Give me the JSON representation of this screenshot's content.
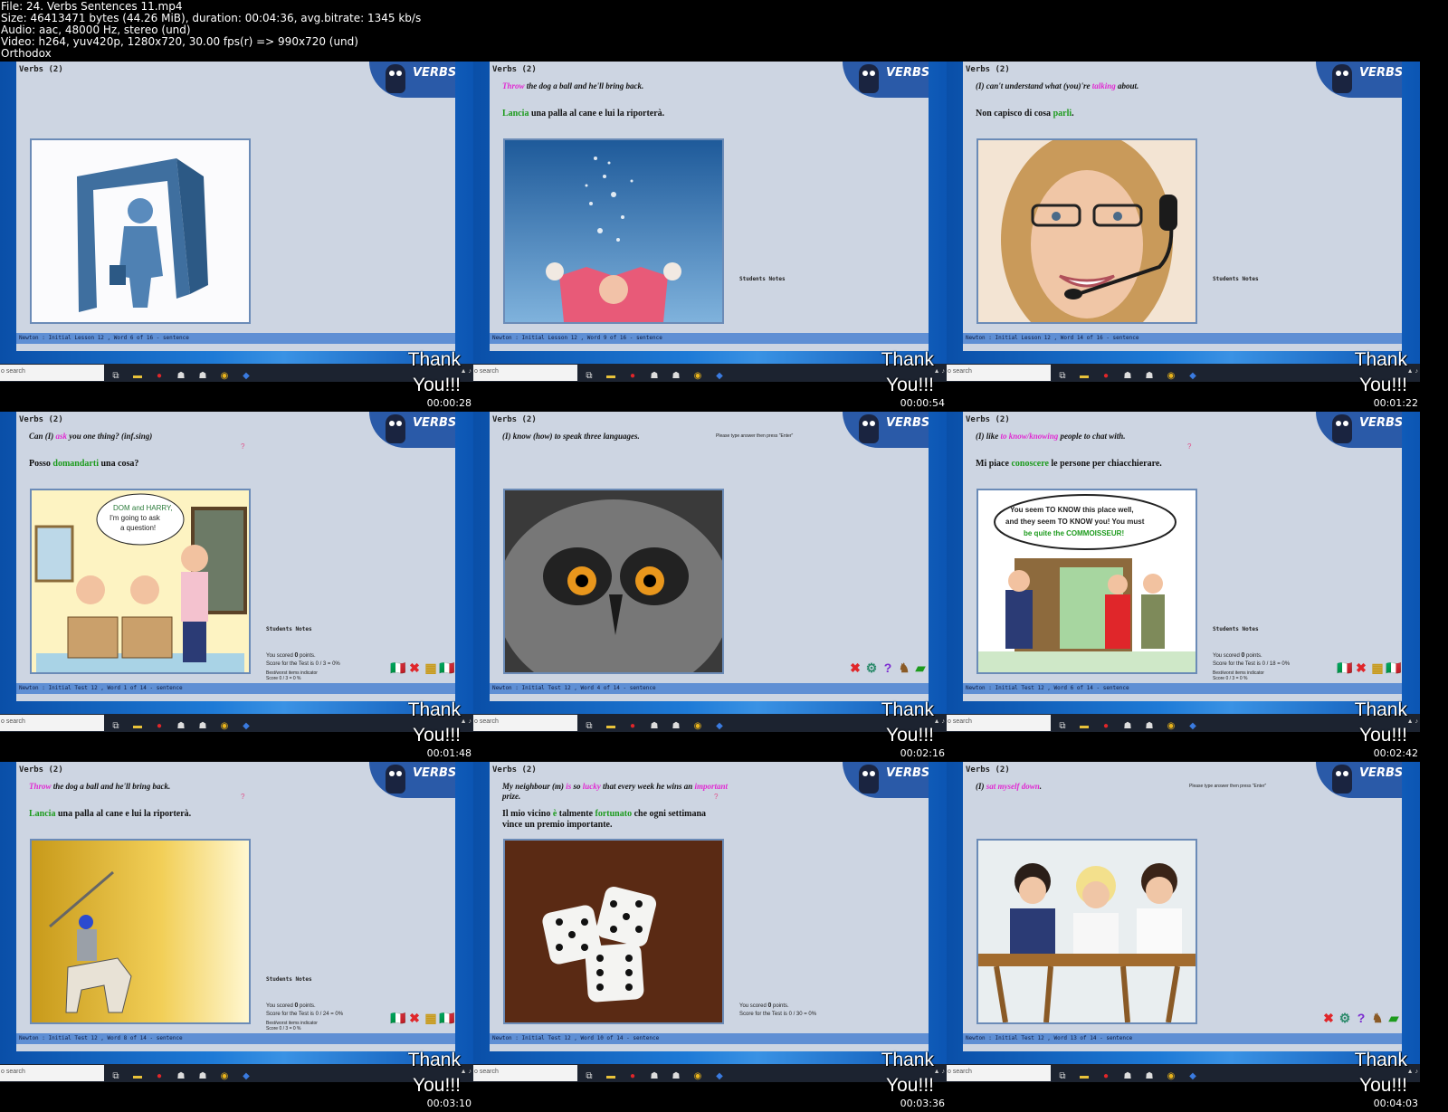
{
  "header": {
    "file": "File: 24. Verbs Sentences 11.mp4",
    "size": "Size: 46413471 bytes (44.26 MiB), duration: 00:04:36, avg.bitrate: 1345 kb/s",
    "audio": "Audio: aac, 48000 Hz, stereo (und)",
    "video": "Video: h264, yuv420p, 1280x720, 30.00 fps(r) => 990x720 (und)",
    "tag": "Orthodox"
  },
  "common": {
    "app_title": "Verbs  (2)",
    "logo_text": "VERBS",
    "search_placeholder": "o search",
    "students_notes": "Students Notes",
    "you_scored_prefix": "You scored ",
    "you_scored_suffix": " points.",
    "thanks_line1": "Thank",
    "thanks_line2": "You!!!",
    "bestworst": "Best/worst items indicator",
    "type_prompt": "Please type answer then press \"Enter\"",
    "question_mark": "?"
  },
  "accent_colors": {
    "english_highlight": "#e12ad2",
    "italian_highlight": "#1d9b1d",
    "app_bg": "#cdd5e2",
    "status_bar": "#5f8fd4"
  },
  "cells": [
    {
      "time": "00:00:28",
      "status": "Newton   :   Initial Lesson 12 , Word 6 of 16        - sentence",
      "en": [
        "",
        "",
        ""
      ],
      "it": [
        "",
        "",
        ""
      ],
      "image": "person-walking-through-door",
      "show_notes": false,
      "show_score": false
    },
    {
      "time": "00:00:54",
      "status": "Newton   :   Initial Lesson 12 , Word 9 of 16        - sentence",
      "en": [
        "",
        "Throw",
        " the dog a ball and he'll bring back."
      ],
      "it": [
        "",
        "Lancia",
        " una palla al cane e lui la riporterà."
      ],
      "image": "child-throwing-snow",
      "show_notes": true,
      "show_score": false
    },
    {
      "time": "00:01:22",
      "status": "Newton   :   Initial Lesson 12 , Word 14 of 16        - sentence",
      "en": [
        "(I) can't understand what (you)'re ",
        "talking",
        " about."
      ],
      "it": [
        "Non capisco di cosa ",
        "parli",
        "."
      ],
      "image": "woman-with-headset",
      "show_notes": true,
      "show_score": false
    },
    {
      "time": "00:01:48",
      "status": "Newton   :   Initial Test 12 , Word 1 of 14 -  sentence",
      "en": [
        "Can (I) ",
        "ask",
        " you one thing? (inf.sing)"
      ],
      "it": [
        "Posso ",
        "domandarti",
        " una cosa?"
      ],
      "image": "cartoon-classroom",
      "cartoon_text": [
        "DOM and HARRY,",
        "I'm going to ask",
        "a question!"
      ],
      "show_notes": true,
      "show_score": true,
      "show_qm": true,
      "scored": "0",
      "score_test": "Score for the Test is 0 / 3 = 0%",
      "score_small": "Score  0 / 3 = 0 %",
      "controls": "set-a"
    },
    {
      "time": "00:02:16",
      "status": "Newton   :   Initial Test 12 , Word 4 of 14 -  sentence",
      "en": [
        "(I) know (how) to speak three languages.",
        "",
        ""
      ],
      "it": [
        "",
        "",
        ""
      ],
      "image": "owl-closeup",
      "show_notes": false,
      "show_score": false,
      "show_prompt": true,
      "controls": "set-b"
    },
    {
      "time": "00:02:42",
      "status": "Newton   :   Initial Test 12 , Word 6 of 14 -  sentence",
      "en": [
        "(I) like ",
        "to know/knowing",
        " people to chat with."
      ],
      "it": [
        "Mi piace ",
        "conoscere",
        " le persone per chiacchierare."
      ],
      "image": "cartoon-connoisseur",
      "cartoon_text": [
        "You seem TO KNOW this place well,",
        "and they seem TO KNOW you! You must",
        "be quite the COMMOISSEUR!"
      ],
      "show_notes": true,
      "show_score": true,
      "show_qm": true,
      "scored": "0",
      "score_test": "Score for the Test is 0 / 18 = 0%",
      "score_small": "Score  0 / 3 = 0 %",
      "controls": "set-a"
    },
    {
      "time": "00:03:10",
      "status": "Newton   :   Initial Test 12 , Word 8 of 14 -  sentence",
      "en": [
        "",
        "Throw",
        " the dog a ball and he'll bring back."
      ],
      "it": [
        "",
        "Lancia",
        " una palla al cane e lui la riporterà."
      ],
      "image": "knight-on-horse",
      "show_notes": true,
      "show_score": true,
      "show_qm": true,
      "scored": "0",
      "score_test": "Score for the Test is 0 / 24 = 0%",
      "score_small": "Score  0 / 3 = 0 %",
      "controls": "set-a"
    },
    {
      "time": "00:03:36",
      "status": "Newton   :   Initial Test 12 , Word 10 of 14 -  sentence",
      "en": [
        "My neighbour (m) ",
        "is",
        " so ",
        "lucky",
        " that every week he wins an ",
        "important",
        " prize."
      ],
      "it": [
        "Il mio vicino ",
        "è",
        " talmente ",
        "fortunato",
        " che ogni settimana vince un premio importante."
      ],
      "image": "dice",
      "show_notes": false,
      "show_score": true,
      "show_qm": true,
      "scored": "0",
      "score_test": "Score for the Test is 0 / 30 = 0%",
      "score_small": "",
      "controls": "none"
    },
    {
      "time": "00:04:03",
      "status": "Newton   :   Initial Test 12 , Word 13 of 14 -  sentence",
      "en": [
        "(I) ",
        "sat myself down",
        "."
      ],
      "it": [
        "",
        "",
        ""
      ],
      "image": "three-women-at-table",
      "show_notes": false,
      "show_score": false,
      "show_prompt": true,
      "controls": "set-b"
    }
  ]
}
